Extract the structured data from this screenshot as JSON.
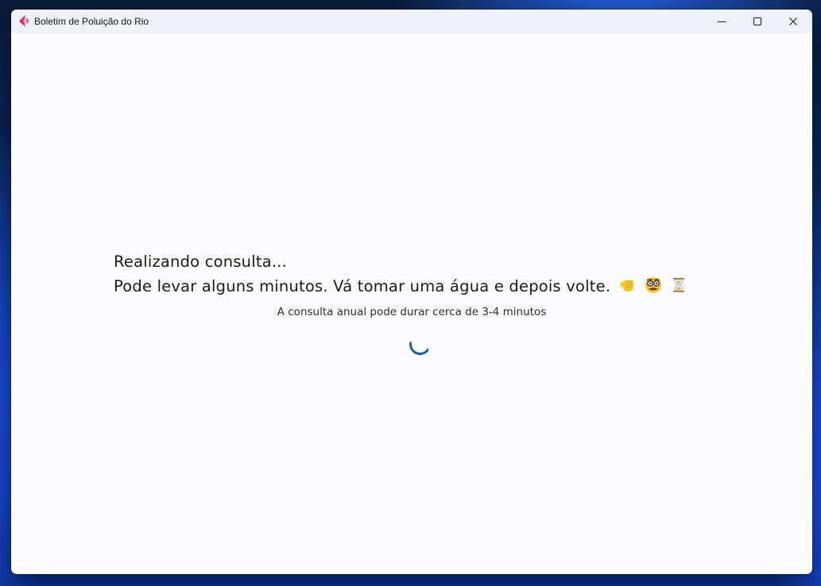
{
  "window": {
    "title": "Boletim de Poluição do Rio"
  },
  "loading": {
    "heading": "Realizando consulta...",
    "message": "Pode levar alguns minutos. Vá tomar uma água e depois volte.",
    "emojis": [
      "fist-icon",
      "disguised-face-icon",
      "hourglass-icon"
    ],
    "note": "A consulta anual pode durar cerca de 3-4 minutos",
    "spinner_color": "#1f5fa8"
  },
  "colors": {
    "accent_red": "#e0245e",
    "accent_pink": "#ff5a8c",
    "titlebar": "#eef1f8",
    "content_bg": "#fcfcfe"
  }
}
